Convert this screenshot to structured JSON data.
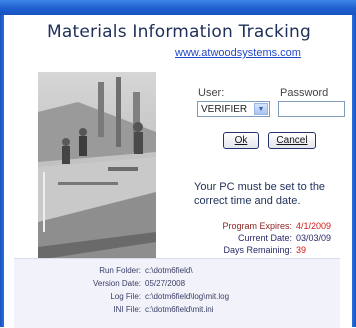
{
  "window": {
    "title": "Materials Information Tracking",
    "website": "www.atwoodsystems.com"
  },
  "login": {
    "user_label": "User:",
    "password_label": "Password",
    "user_selected": "VERIFIER",
    "password_value": "",
    "ok_label": "Ok",
    "cancel_label": "Cancel"
  },
  "message": "Your PC must be set to the correct time and date.",
  "status": {
    "program_expires_label": "Program Expires:",
    "program_expires_value": "4/1/2009",
    "current_date_label": "Current Date:",
    "current_date_value": "03/03/09",
    "days_remaining_label": "Days Remaining:",
    "days_remaining_value": "39",
    "alert_color": "#d11a1a",
    "normal_color": "#2a2a6a"
  },
  "footer": {
    "run_folder_label": "Run Folder:",
    "run_folder_value": "c:\\dotm6field\\",
    "version_date_label": "Version Date:",
    "version_date_value": "05/27/2008",
    "log_file_label": "Log File:",
    "log_file_value": "c:\\dotm6field\\log\\mit.log",
    "ini_file_label": "INI File:",
    "ini_file_value": "c:\\dotm6field\\mit.ini"
  },
  "colors": {
    "titlebar": "#1f5fd0",
    "link": "#2447c9",
    "heading": "#1e2f59"
  }
}
